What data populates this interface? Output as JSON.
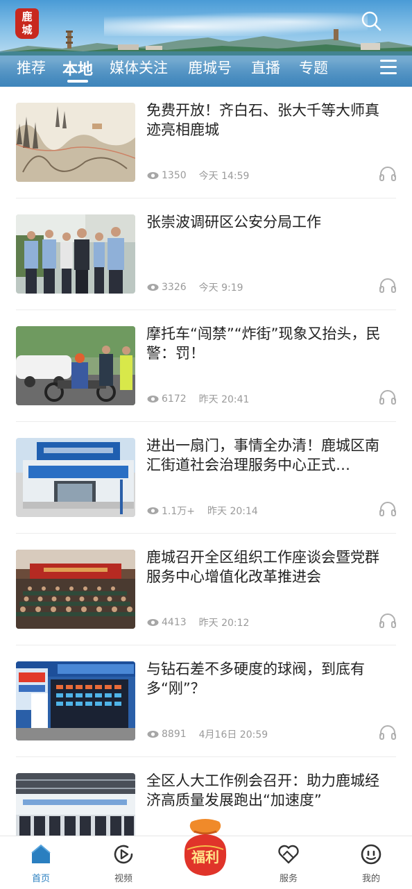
{
  "header": {
    "logo_text": "鹿城",
    "search_icon": "search-icon",
    "menu_icon": "menu-icon"
  },
  "tabs": [
    {
      "label": "推荐",
      "active": false
    },
    {
      "label": "本地",
      "active": true
    },
    {
      "label": "媒体关注",
      "active": false
    },
    {
      "label": "鹿城号",
      "active": false
    },
    {
      "label": "直播",
      "active": false
    },
    {
      "label": "专题",
      "active": false
    }
  ],
  "feed": [
    {
      "title": "免费开放！齐白石、张大千等大师真迹亮相鹿城",
      "views": "1350",
      "time": "今天  14:59",
      "thumb": "painting"
    },
    {
      "title": "张崇波调研区公安分局工作",
      "views": "3326",
      "time": "今天  9:19",
      "thumb": "police-group"
    },
    {
      "title": "摩托车“闯禁”“炸街”现象又抬头，民警：罚！",
      "views": "6172",
      "time": "昨天  20:41",
      "thumb": "motorcycle-stop"
    },
    {
      "title": "进出一扇门，事情全办清！鹿城区南汇街道社会治理服务中心正式…",
      "views": "1.1万+",
      "time": "昨天  20:14",
      "thumb": "service-center"
    },
    {
      "title": "鹿城召开全区组织工作座谈会暨党群服务中心增值化改革推进会",
      "views": "4413",
      "time": "昨天  20:12",
      "thumb": "conference-hall"
    },
    {
      "title": "与钻石差不多硬度的球阀，到底有多“刚”？",
      "views": "8891",
      "time": "4月16日  20:59",
      "thumb": "tech-exhibit"
    },
    {
      "title": "全区人大工作例会召开：助力鹿城经济高质量发展跑出“加速度”",
      "views": "",
      "time": "",
      "thumb": "meeting-room"
    }
  ],
  "bottom_nav": {
    "home": "首页",
    "video": "视频",
    "fuli": "福利",
    "service": "服务",
    "mine": "我的"
  },
  "colors": {
    "accent": "#2a7fc0",
    "logo_red": "#c8281e",
    "fuli_red": "#e0342a"
  }
}
